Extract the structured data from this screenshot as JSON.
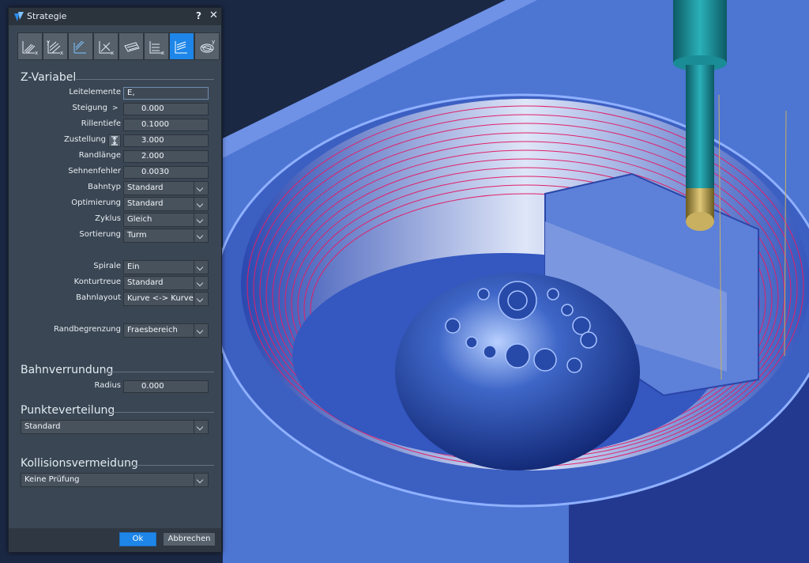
{
  "dialog": {
    "title": "Strategie",
    "help": "?",
    "close": "✕"
  },
  "toolbar": {
    "icons": [
      "strategy-parallel-x-icon",
      "strategy-parallel-y-icon",
      "strategy-contour-icon",
      "strategy-offset-x-icon",
      "strategy-plane-icon",
      "strategy-z-levels-icon",
      "strategy-z-variable-icon",
      "strategy-spiral-z-icon"
    ],
    "active_index": 6
  },
  "zvariabel": {
    "heading": "Z-Variabel",
    "leitelemente": {
      "label": "Leitelemente",
      "value": "E,"
    },
    "steigung": {
      "label": "Steigung",
      "icon": ">",
      "value": "0.000"
    },
    "rillentiefe": {
      "label": "Rillentiefe",
      "value": "0.1000"
    },
    "zustellung": {
      "label": "Zustellung",
      "value": "3.000"
    },
    "randlaenge": {
      "label": "Randlänge",
      "value": "2.000"
    },
    "sehnenfehler": {
      "label": "Sehnenfehler",
      "value": "0.0030"
    },
    "bahntyp": {
      "label": "Bahntyp",
      "value": "Standard"
    },
    "optimierung": {
      "label": "Optimierung",
      "value": "Standard"
    },
    "zyklus": {
      "label": "Zyklus",
      "value": "Gleich"
    },
    "sortierung": {
      "label": "Sortierung",
      "value": "Turm"
    },
    "spirale": {
      "label": "Spirale",
      "value": "Ein"
    },
    "konturtreue": {
      "label": "Konturtreue",
      "value": "Standard"
    },
    "bahnlayout": {
      "label": "Bahnlayout",
      "value": "Kurve <-> Kurve"
    },
    "randbegrenzung": {
      "label": "Randbegrenzung",
      "value": "Fraesbereich"
    }
  },
  "bahnverrundung": {
    "heading": "Bahnverrundung",
    "radius": {
      "label": "Radius",
      "value": "0.000"
    }
  },
  "punkteverteilung": {
    "heading": "Punkteverteilung",
    "value": "Standard"
  },
  "kollisionsvermeidung": {
    "heading": "Kollisionsvermeidung",
    "value": "Keine Prüfung"
  },
  "buttons": {
    "ok": "Ok",
    "cancel": "Abbrechen"
  },
  "colors": {
    "accent": "#1e86e8",
    "toolpath": "#e0206a",
    "part": "#4a73cf"
  }
}
